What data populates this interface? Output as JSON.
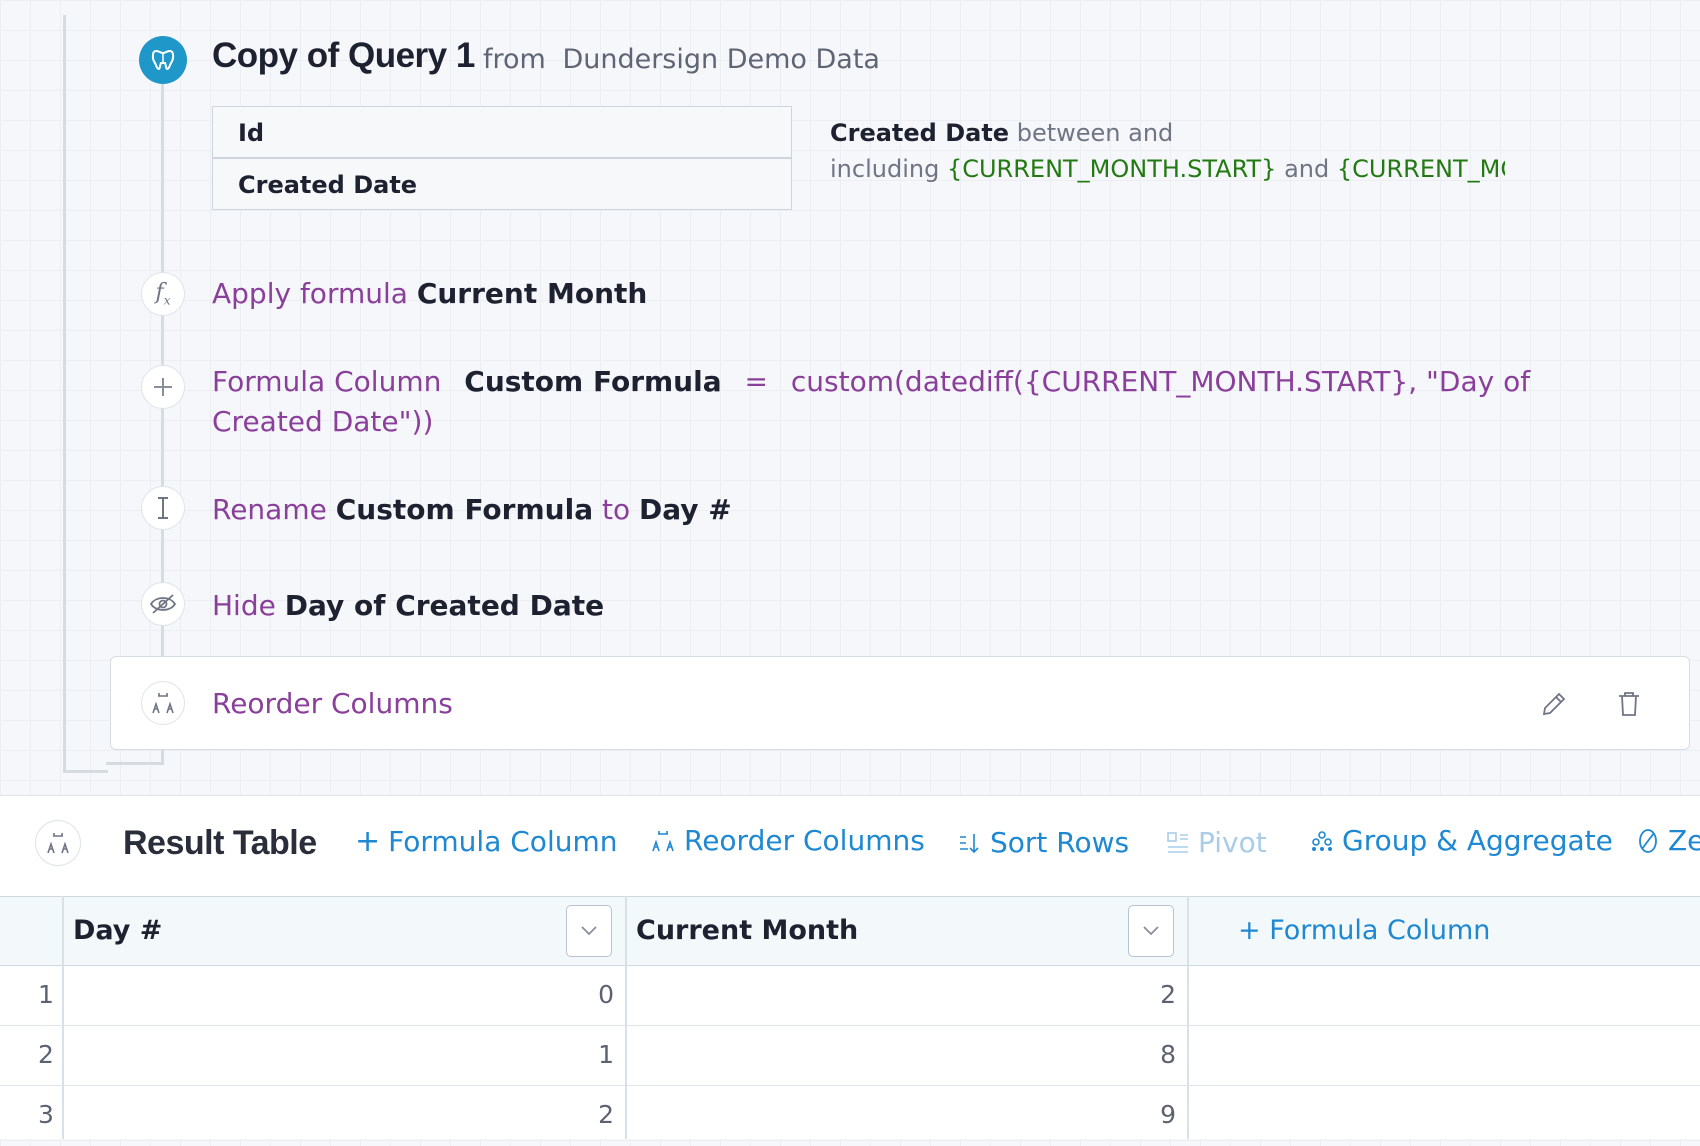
{
  "query": {
    "title": "Copy of Query 1",
    "from_label": "from",
    "source": "Dundersign Demo Data",
    "fields": [
      "Id",
      "Created Date"
    ],
    "filter": {
      "field": "Created Date",
      "op1": "between and",
      "op2": "including",
      "start": "{CURRENT_MONTH.START}",
      "and": "and",
      "end": "{CURRENT_MONTI"
    }
  },
  "steps": {
    "apply_formula": {
      "action": "Apply formula",
      "target": "Current Month"
    },
    "formula_column": {
      "action": "Formula Column",
      "name": "Custom Formula",
      "equals": "=",
      "expr1": "custom(datediff({CURRENT_MONTH.START}, \"Day of",
      "expr2": "Created Date\"))"
    },
    "rename": {
      "action": "Rename",
      "from": "Custom Formula",
      "to_word": "to",
      "to": "Day #"
    },
    "hide": {
      "action": "Hide",
      "target": "Day of Created Date"
    },
    "reorder": {
      "action": "Reorder Columns"
    }
  },
  "result": {
    "title": "Result Table",
    "toolbar": {
      "formula_column": "Formula Column",
      "reorder_columns": "Reorder Columns",
      "sort_rows": "Sort Rows",
      "pivot": "Pivot",
      "group_aggregate": "Group & Aggregate",
      "zero_fill": "Ze"
    },
    "columns": [
      "Day #",
      "Current Month"
    ],
    "add_column": "Formula Column",
    "rows": [
      {
        "num": "1",
        "day": "0",
        "month": "2"
      },
      {
        "num": "2",
        "day": "1",
        "month": "8"
      },
      {
        "num": "3",
        "day": "2",
        "month": "9"
      }
    ]
  },
  "colors": {
    "accent_blue": "#1e88d2",
    "step_purple": "#8a3f9b",
    "variable_green": "#237a12",
    "source_blue": "#1f97c9"
  }
}
